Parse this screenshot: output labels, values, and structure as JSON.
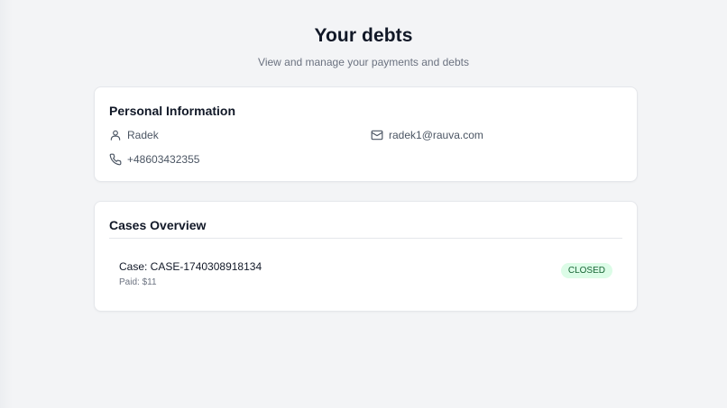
{
  "header": {
    "title": "Your debts",
    "subtitle": "View and manage your payments and debts"
  },
  "personal": {
    "title": "Personal Information",
    "name": "Radek",
    "email": "radek1@rauva.com",
    "phone": "+48603432355",
    "icons": {
      "name": "user-icon",
      "email": "mail-icon",
      "phone": "phone-icon"
    }
  },
  "cases": {
    "title": "Cases Overview",
    "items": [
      {
        "case": "Case: CASE-1740308918134",
        "paid": "Paid: $11",
        "status": "CLOSED"
      }
    ]
  },
  "colors": {
    "background": "#f3f4f6",
    "card": "#ffffff",
    "badge_bg": "#dcfce7",
    "badge_text": "#166534"
  }
}
